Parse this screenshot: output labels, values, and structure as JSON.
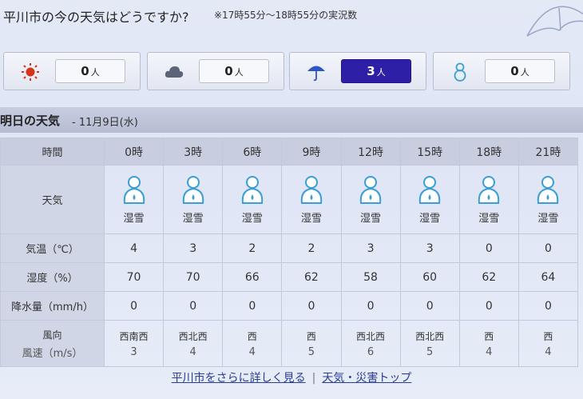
{
  "header": {
    "title": "平川市の今の天気はどうですか?",
    "note": "※17時55分～18時55分の実況数"
  },
  "counts": [
    {
      "icon": "sun-icon",
      "value": "0",
      "unit": "人",
      "active": false
    },
    {
      "icon": "cloud-icon",
      "value": "0",
      "unit": "人",
      "active": false
    },
    {
      "icon": "umbrella-icon",
      "value": "3",
      "unit": "人",
      "active": true
    },
    {
      "icon": "snowman-icon",
      "value": "0",
      "unit": "人",
      "active": false
    }
  ],
  "tomorrow": {
    "title": "明日の天気",
    "date": "- 11月9日(水)"
  },
  "table": {
    "row_labels": {
      "time": "時間",
      "weather": "天気",
      "temp": "気温（℃）",
      "humidity": "湿度（%）",
      "precip": "降水量（mm/h）",
      "wind_dir": "風向",
      "wind_speed": "風速（m/s）"
    },
    "times": [
      "0時",
      "3時",
      "6時",
      "9時",
      "12時",
      "15時",
      "18時",
      "21時"
    ],
    "weather": [
      "湿雪",
      "湿雪",
      "湿雪",
      "湿雪",
      "湿雪",
      "湿雪",
      "湿雪",
      "湿雪"
    ],
    "weather_icon": "wet-snow-icon",
    "temp": [
      "4",
      "3",
      "2",
      "2",
      "3",
      "3",
      "0",
      "0"
    ],
    "humidity": [
      "70",
      "70",
      "66",
      "62",
      "58",
      "60",
      "62",
      "64"
    ],
    "precip": [
      "0",
      "0",
      "0",
      "0",
      "0",
      "0",
      "0",
      "0"
    ],
    "wind_dir": [
      "西南西",
      "西北西",
      "西",
      "西",
      "西北西",
      "西北西",
      "西",
      "西"
    ],
    "wind_speed": [
      "3",
      "4",
      "4",
      "5",
      "6",
      "5",
      "4",
      "4"
    ]
  },
  "footer": {
    "link1": "平川市をさらに詳しく見る",
    "separator": "|",
    "link2": "天気・災害トップ"
  },
  "colors": {
    "active_count_bg": "#2e1fa7",
    "sun": "#d6321c",
    "cloud": "#5c6478",
    "umbrella": "#2b56c8",
    "snowman": "#3a9ed8",
    "link": "#2a3b9b"
  }
}
